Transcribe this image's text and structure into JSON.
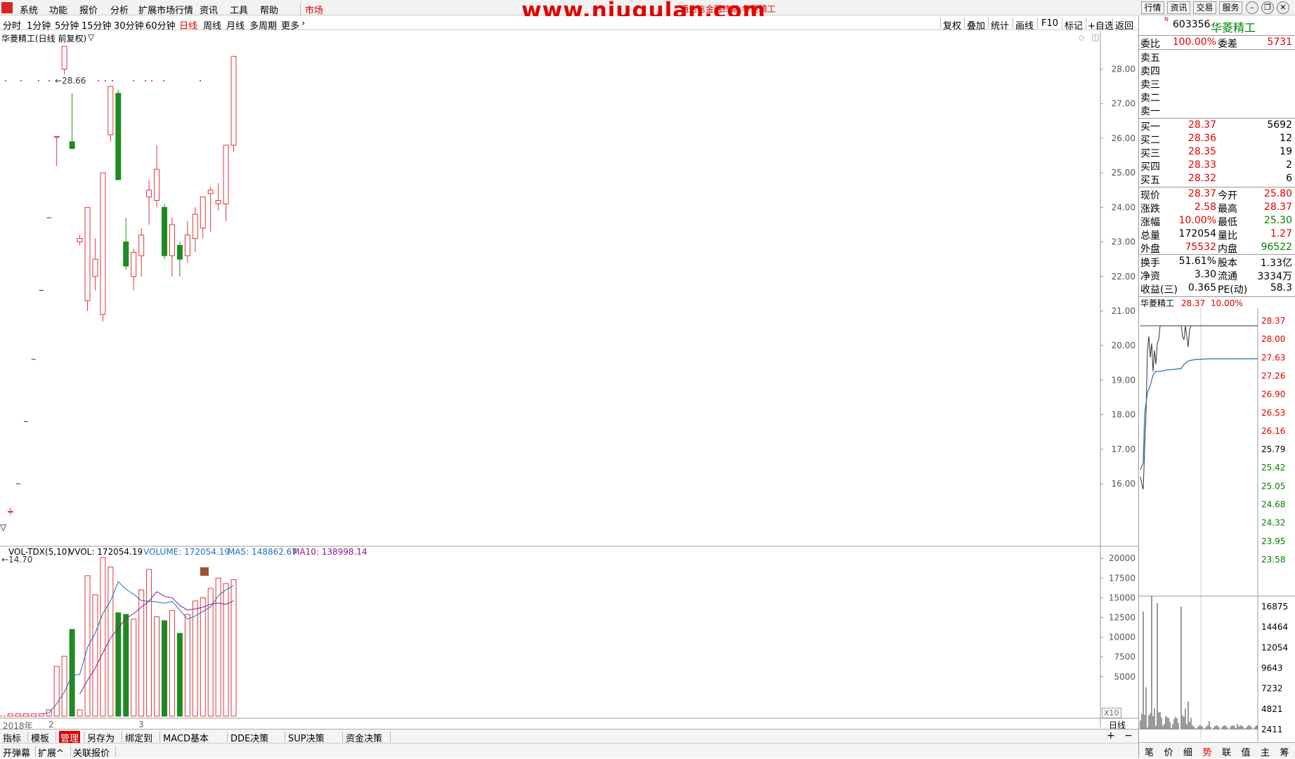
{
  "menu": {
    "items": [
      "系统",
      "功能",
      "报价",
      "分析",
      "扩展市场行情",
      "资讯",
      "工具",
      "帮助"
    ],
    "market": "市场",
    "watermark": "www.niugulan.com",
    "title": "通达信金融终端 华菱精工",
    "right_buttons": [
      "行情",
      "资讯",
      "交易",
      "服务"
    ]
  },
  "period_bar": {
    "items": [
      "分时",
      "1分钟",
      "5分钟",
      "15分钟",
      "30分钟",
      "60分钟",
      "日线",
      "周线",
      "月线",
      "多周期",
      "更多"
    ],
    "active": "日线",
    "tools": [
      "复权",
      "叠加",
      "统计",
      "画线",
      "F10",
      "标记",
      "+自选",
      "返回"
    ]
  },
  "chart": {
    "title": "华菱精工(日线 前复权)",
    "high_marker": "28.66",
    "low_marker": "14.70",
    "price_axis": [
      "28.00",
      "27.00",
      "26.00",
      "25.00",
      "24.00",
      "23.00",
      "22.00",
      "21.00",
      "20.00",
      "19.00",
      "18.00",
      "17.00",
      "16.00"
    ],
    "vol_axis": [
      "20000",
      "17500",
      "15000",
      "12500",
      "10000",
      "7500",
      "5000"
    ],
    "vol_unit": "X10",
    "date_labels": [
      "2018年",
      "2",
      "3"
    ],
    "period_label": "日线"
  },
  "chart_data": {
    "type": "candlestick",
    "ylim": [
      14.7,
      28.66
    ],
    "candles": [
      {
        "o": 15.2,
        "h": 15.3,
        "l": 15.1,
        "c": 15.2
      },
      {
        "o": 16.0,
        "h": 16.1,
        "l": 15.95,
        "c": 16.0
      },
      {
        "o": 17.8,
        "h": 17.9,
        "l": 17.75,
        "c": 17.8
      },
      {
        "o": 19.6,
        "h": 19.7,
        "l": 19.55,
        "c": 19.6
      },
      {
        "o": 21.6,
        "h": 21.7,
        "l": 21.55,
        "c": 21.6
      },
      {
        "o": 23.7,
        "h": 23.8,
        "l": 23.65,
        "c": 23.7
      },
      {
        "o": 26.05,
        "h": 26.05,
        "l": 25.2,
        "c": 26.05
      },
      {
        "o": 28.0,
        "h": 28.66,
        "l": 27.85,
        "c": 28.66
      },
      {
        "o": 25.9,
        "h": 27.3,
        "l": 25.7,
        "c": 25.7
      },
      {
        "o": 23.0,
        "h": 23.2,
        "l": 22.9,
        "c": 23.1
      },
      {
        "o": 21.3,
        "h": 24.0,
        "l": 21.0,
        "c": 24.0
      },
      {
        "o": 22.0,
        "h": 23.1,
        "l": 21.6,
        "c": 22.5
      },
      {
        "o": 20.9,
        "h": 25.0,
        "l": 20.7,
        "c": 25.0
      },
      {
        "o": 26.1,
        "h": 27.5,
        "l": 25.9,
        "c": 27.5
      },
      {
        "o": 27.3,
        "h": 27.4,
        "l": 24.8,
        "c": 24.8
      },
      {
        "o": 23.0,
        "h": 23.7,
        "l": 22.2,
        "c": 22.3
      },
      {
        "o": 22.0,
        "h": 22.8,
        "l": 21.6,
        "c": 22.7
      },
      {
        "o": 22.6,
        "h": 23.4,
        "l": 22.0,
        "c": 23.2
      },
      {
        "o": 24.3,
        "h": 24.8,
        "l": 23.5,
        "c": 24.5
      },
      {
        "o": 24.2,
        "h": 25.8,
        "l": 24.0,
        "c": 25.1
      },
      {
        "o": 24.0,
        "h": 24.1,
        "l": 22.5,
        "c": 22.6
      },
      {
        "o": 22.6,
        "h": 23.7,
        "l": 22.0,
        "c": 23.5
      },
      {
        "o": 22.9,
        "h": 23.0,
        "l": 22.0,
        "c": 22.5
      },
      {
        "o": 22.6,
        "h": 23.6,
        "l": 22.4,
        "c": 23.2
      },
      {
        "o": 23.1,
        "h": 24.0,
        "l": 22.7,
        "c": 23.8
      },
      {
        "o": 23.4,
        "h": 24.3,
        "l": 23.1,
        "c": 24.3
      },
      {
        "o": 24.4,
        "h": 24.6,
        "l": 23.3,
        "c": 24.5
      },
      {
        "o": 24.1,
        "h": 24.7,
        "l": 23.9,
        "c": 24.2
      },
      {
        "o": 24.1,
        "h": 25.8,
        "l": 23.6,
        "c": 25.8
      },
      {
        "o": 25.8,
        "h": 28.37,
        "l": 25.6,
        "c": 28.37
      }
    ],
    "volume": {
      "values": [
        300,
        300,
        300,
        300,
        300,
        800,
        6300,
        7600,
        11000,
        800,
        17800,
        15400,
        20100,
        18900,
        13100,
        12900,
        12300,
        16000,
        18600,
        12600,
        12100,
        13400,
        10500,
        12900,
        14600,
        15000,
        16200,
        17500,
        16800,
        17300
      ],
      "ma5_label": "MA5: 148862.67",
      "ma10_label": "MA10: 138998.14",
      "vol_label": "VVOL: 172054.19",
      "volume_label": "VOLUME: 172054.19",
      "title": "VOL-TDX(5,10)"
    }
  },
  "quote": {
    "code": "603356",
    "name": "华菱精工",
    "weibi_label": "委比",
    "weibi": "100.00%",
    "weicha_label": "委差",
    "weicha": "5731",
    "asks": [
      {
        "label": "卖五",
        "price": "",
        "vol": ""
      },
      {
        "label": "卖四",
        "price": "",
        "vol": ""
      },
      {
        "label": "卖三",
        "price": "",
        "vol": ""
      },
      {
        "label": "卖二",
        "price": "",
        "vol": ""
      },
      {
        "label": "卖一",
        "price": "",
        "vol": ""
      }
    ],
    "bids": [
      {
        "label": "买一",
        "price": "28.37",
        "vol": "5692"
      },
      {
        "label": "买二",
        "price": "28.36",
        "vol": "12"
      },
      {
        "label": "买三",
        "price": "28.35",
        "vol": "19"
      },
      {
        "label": "买四",
        "price": "28.33",
        "vol": "2"
      },
      {
        "label": "买五",
        "price": "28.32",
        "vol": "6"
      }
    ],
    "stats": [
      {
        "l1": "现价",
        "v1": "28.37",
        "c1": "red",
        "l2": "今开",
        "v2": "25.80",
        "c2": "red"
      },
      {
        "l1": "涨跌",
        "v1": "2.58",
        "c1": "red",
        "l2": "最高",
        "v2": "28.37",
        "c2": "red"
      },
      {
        "l1": "涨幅",
        "v1": "10.00%",
        "c1": "red",
        "l2": "最低",
        "v2": "25.30",
        "c2": "green"
      },
      {
        "l1": "总量",
        "v1": "172054",
        "c1": "black",
        "l2": "量比",
        "v2": "1.27",
        "c2": "red"
      },
      {
        "l1": "外盘",
        "v1": "75532",
        "c1": "red",
        "l2": "内盘",
        "v2": "96522",
        "c2": "green"
      }
    ],
    "stats2": [
      {
        "l1": "换手",
        "v1": "51.61%",
        "l2": "股本",
        "v2": "1.33亿"
      },
      {
        "l1": "净资",
        "v1": "3.30",
        "l2": "流通",
        "v2": "3334万"
      },
      {
        "l1": "收益(三)",
        "v1": "0.365",
        "l2": "PE(动)",
        "v2": "58.3"
      }
    ]
  },
  "minichart": {
    "name": "华菱精工",
    "price": "28.37",
    "pct": "10.00%",
    "price_axis": [
      {
        "v": "28.37",
        "c": "red"
      },
      {
        "v": "28.00",
        "c": "red"
      },
      {
        "v": "27.63",
        "c": "red"
      },
      {
        "v": "27.26",
        "c": "red"
      },
      {
        "v": "26.90",
        "c": "red"
      },
      {
        "v": "26.53",
        "c": "red"
      },
      {
        "v": "26.16",
        "c": "red"
      },
      {
        "v": "25.79",
        "c": "black"
      },
      {
        "v": "25.42",
        "c": "green"
      },
      {
        "v": "25.05",
        "c": "green"
      },
      {
        "v": "24.68",
        "c": "green"
      },
      {
        "v": "24.32",
        "c": "green"
      },
      {
        "v": "23.95",
        "c": "green"
      },
      {
        "v": "23.58",
        "c": "green"
      }
    ],
    "vol_axis": [
      "16875",
      "14464",
      "12054",
      "9643",
      "7232",
      "4821",
      "2411"
    ]
  },
  "bottom": {
    "tabs": [
      "指标",
      "模板",
      "管理",
      "另存为",
      "绑定到",
      "MACD基本",
      "DDE决策",
      "SUP决策",
      "资金决策"
    ],
    "active_tab": "管理",
    "tabs2": [
      "开弹幕",
      "扩展^",
      "关联报价"
    ],
    "right_tabs": [
      "笔",
      "价",
      "细",
      "势",
      "联",
      "值",
      "主",
      "筹"
    ],
    "right_active": "势"
  }
}
